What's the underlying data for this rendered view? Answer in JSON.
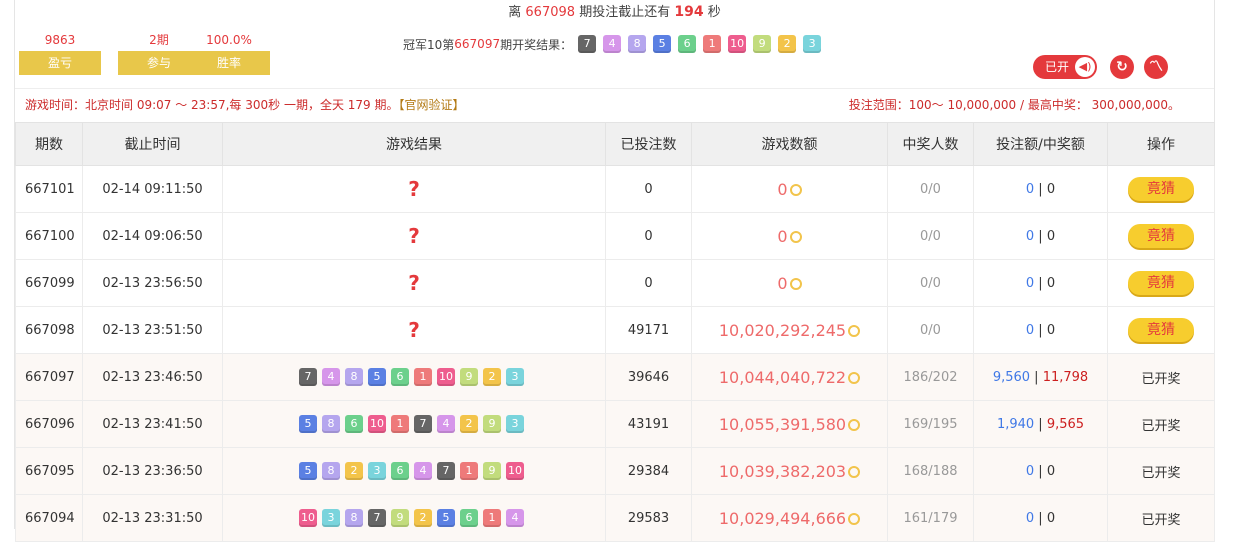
{
  "header": {
    "countdown_prefix": "离",
    "countdown_period": "667098",
    "countdown_middle": "期投注截止还有",
    "countdown_seconds": "194",
    "countdown_suffix": "秒"
  },
  "stats": [
    {
      "value": "9863",
      "label": "盈亏"
    },
    {
      "value": "2期",
      "label": "参与"
    },
    {
      "value": "100.0%",
      "label": "胜率"
    }
  ],
  "last_result": {
    "prefix": "冠军10第",
    "period": "667097",
    "suffix": "期开奖结果：",
    "balls": [
      7,
      4,
      8,
      5,
      6,
      1,
      10,
      9,
      2,
      3
    ]
  },
  "controls": {
    "opened_label": "已开"
  },
  "info": {
    "time_text": "游戏时间：北京时间 09:07 ～ 23:57,每 300秒 一期，全天 179 期。",
    "verify": "【官网验证】",
    "range_text": "投注范围：100～ 10,000,000 / 最高中奖： 300,000,000。"
  },
  "table": {
    "headers": [
      "期数",
      "截止时间",
      "游戏结果",
      "已投注数",
      "游戏数额",
      "中奖人数",
      "投注额/中奖额",
      "操作"
    ],
    "bet_label": "竟猜",
    "drawn_label": "已开奖",
    "rows": [
      {
        "period": "667101",
        "time": "02-14 09:11:50",
        "result": null,
        "bets": "0",
        "amount": "0",
        "winners": "0/0",
        "bet_amt": "0",
        "win_amt": "0",
        "action": "bet"
      },
      {
        "period": "667100",
        "time": "02-14 09:06:50",
        "result": null,
        "bets": "0",
        "amount": "0",
        "winners": "0/0",
        "bet_amt": "0",
        "win_amt": "0",
        "action": "bet"
      },
      {
        "period": "667099",
        "time": "02-13 23:56:50",
        "result": null,
        "bets": "0",
        "amount": "0",
        "winners": "0/0",
        "bet_amt": "0",
        "win_amt": "0",
        "action": "bet"
      },
      {
        "period": "667098",
        "time": "02-13 23:51:50",
        "result": null,
        "bets": "49171",
        "amount": "10,020,292,245",
        "winners": "0/0",
        "bet_amt": "0",
        "win_amt": "0",
        "action": "bet"
      },
      {
        "period": "667097",
        "time": "02-13 23:46:50",
        "result": [
          7,
          4,
          8,
          5,
          6,
          1,
          10,
          9,
          2,
          3
        ],
        "bets": "39646",
        "amount": "10,044,040,722",
        "winners": "186/202",
        "bet_amt": "9,560",
        "win_amt": "11,798",
        "action": "drawn"
      },
      {
        "period": "667096",
        "time": "02-13 23:41:50",
        "result": [
          5,
          8,
          6,
          10,
          1,
          7,
          4,
          2,
          9,
          3
        ],
        "bets": "43191",
        "amount": "10,055,391,580",
        "winners": "169/195",
        "bet_amt": "1,940",
        "win_amt": "9,565",
        "action": "drawn"
      },
      {
        "period": "667095",
        "time": "02-13 23:36:50",
        "result": [
          5,
          8,
          2,
          3,
          6,
          4,
          7,
          1,
          9,
          10
        ],
        "bets": "29384",
        "amount": "10,039,382,203",
        "winners": "168/188",
        "bet_amt": "0",
        "win_amt": "0",
        "action": "drawn"
      },
      {
        "period": "667094",
        "time": "02-13 23:31:50",
        "result": [
          10,
          3,
          8,
          7,
          9,
          2,
          5,
          6,
          1,
          4
        ],
        "bets": "29583",
        "amount": "10,029,494,666",
        "winners": "161/179",
        "bet_amt": "0",
        "win_amt": "0",
        "action": "drawn"
      }
    ]
  }
}
